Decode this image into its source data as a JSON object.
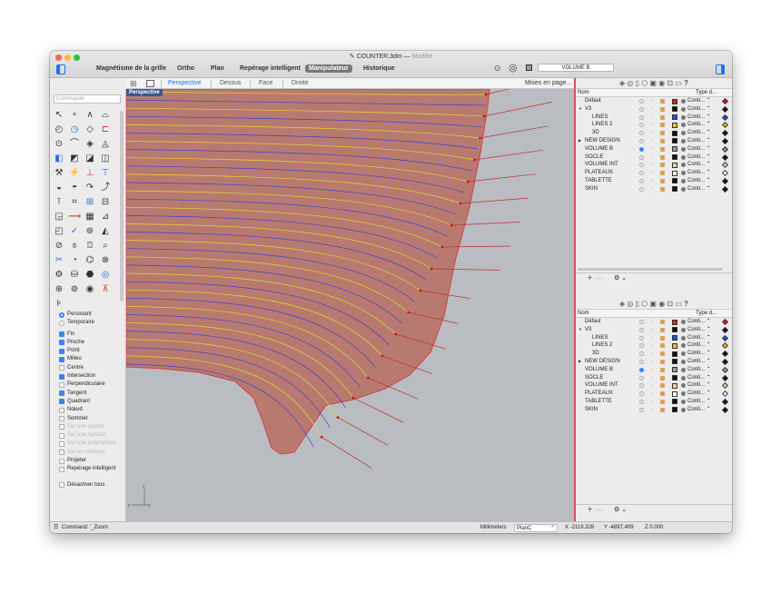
{
  "window": {
    "title": "COUNTER.3dm",
    "status": "Modifié"
  },
  "toolbar": {
    "items": [
      "Magnétisme de la grille",
      "Ortho",
      "Plan",
      "Repérage intelligent",
      "Manipulateur",
      "Historique"
    ],
    "active_index": 4,
    "layer_name": "VOLUME B"
  },
  "viewtabs": {
    "tabs": [
      "Perspective",
      "Dessus",
      "Face",
      "Droite"
    ],
    "active": "Perspective",
    "menu": "Mises en page..."
  },
  "viewport": {
    "label": "Perspective"
  },
  "sidebar": {
    "command_placeholder": "Commande"
  },
  "snaps": [
    {
      "label": "Persistant",
      "type": "radio",
      "checked": true,
      "disabled": false
    },
    {
      "label": "Temporaire",
      "type": "radio",
      "checked": false,
      "disabled": false
    },
    {
      "label": "Fin",
      "type": "check",
      "checked": true,
      "disabled": false
    },
    {
      "label": "Proche",
      "type": "check",
      "checked": true,
      "disabled": false
    },
    {
      "label": "Point",
      "type": "check",
      "checked": true,
      "disabled": false
    },
    {
      "label": "Milieu",
      "type": "check",
      "checked": true,
      "disabled": false
    },
    {
      "label": "Centre",
      "type": "check",
      "checked": false,
      "disabled": false
    },
    {
      "label": "Intersection",
      "type": "check",
      "checked": true,
      "disabled": false
    },
    {
      "label": "Perpendiculaire",
      "type": "check",
      "checked": false,
      "disabled": false
    },
    {
      "label": "Tangent",
      "type": "check",
      "checked": true,
      "disabled": false
    },
    {
      "label": "Quadrant",
      "type": "check",
      "checked": true,
      "disabled": false
    },
    {
      "label": "Nœud",
      "type": "check",
      "checked": false,
      "disabled": false
    },
    {
      "label": "Sommet",
      "type": "check",
      "checked": false,
      "disabled": false
    },
    {
      "label": "Sur une courbe",
      "type": "check",
      "checked": false,
      "disabled": true
    },
    {
      "label": "Sur une surface",
      "type": "check",
      "checked": false,
      "disabled": true
    },
    {
      "label": "Sur une polysurface",
      "type": "check",
      "checked": false,
      "disabled": true
    },
    {
      "label": "Sur un maillage",
      "type": "check",
      "checked": false,
      "disabled": true
    },
    {
      "label": "Projeter",
      "type": "check",
      "checked": false,
      "disabled": false
    },
    {
      "label": "Repérage intelligent",
      "type": "check",
      "checked": false,
      "disabled": false
    }
  ],
  "snaps_disable": "Désactiver tous",
  "layers": {
    "col_name": "Nom",
    "col_type": "Type d...",
    "rows": [
      {
        "name": "Défaut",
        "indent": 1,
        "color": "#e02020",
        "line": "Conti...",
        "current": false,
        "arrow": "",
        "diamond": "#e02020"
      },
      {
        "name": "V3",
        "indent": 0,
        "color": "#111111",
        "line": "Conti...",
        "current": false,
        "arrow": "▼",
        "diamond": "#111111"
      },
      {
        "name": "LINES",
        "indent": 2,
        "color": "#1f4fe0",
        "line": "Conti...",
        "current": false,
        "arrow": "",
        "diamond": "#1f4fe0"
      },
      {
        "name": "LINES 2",
        "indent": 2,
        "color": "#f0c020",
        "line": "Conti...",
        "current": false,
        "arrow": "",
        "diamond": "#f0c020"
      },
      {
        "name": "3D",
        "indent": 2,
        "color": "#111111",
        "line": "Conti...",
        "current": false,
        "arrow": "",
        "diamond": "#111111"
      },
      {
        "name": "NEW DESIGN",
        "indent": 0,
        "color": "#111111",
        "line": "Conti...",
        "current": false,
        "arrow": "▶",
        "diamond": "#111111"
      },
      {
        "name": "VOLUME B",
        "indent": 1,
        "color": "#9a9a88",
        "line": "Conti...",
        "current": true,
        "arrow": "",
        "diamond": "#9a9a88"
      },
      {
        "name": "SOCLE",
        "indent": 1,
        "color": "#111111",
        "line": "Conti...",
        "current": false,
        "arrow": "",
        "diamond": "#111111"
      },
      {
        "name": "VOLUME INT",
        "indent": 1,
        "color": "#f2cfa6",
        "line": "Conti...",
        "current": false,
        "arrow": "",
        "diamond": "#f2cfa6"
      },
      {
        "name": "PLATEAUX",
        "indent": 1,
        "color": "#ffffff",
        "line": "Conti...",
        "current": false,
        "arrow": "",
        "diamond": "#ffffff"
      },
      {
        "name": "TABLETTE",
        "indent": 1,
        "color": "#111111",
        "line": "Conti...",
        "current": false,
        "arrow": "",
        "diamond": "#111111"
      },
      {
        "name": "SKIN",
        "indent": 1,
        "color": "#111111",
        "line": "Conti...",
        "current": false,
        "arrow": "",
        "diamond": "#111111"
      }
    ]
  },
  "status": {
    "command": "Command: '_Zoom",
    "units": "Millimeters",
    "cplane": "PlanC",
    "x": "X -2119.328",
    "y": "Y -4897.409",
    "z": "Z 0.000"
  }
}
